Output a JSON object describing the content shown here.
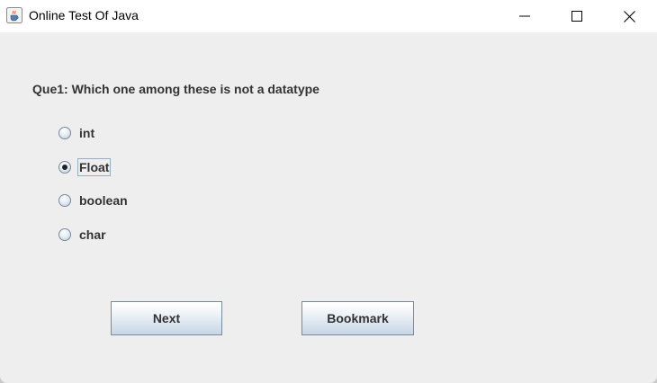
{
  "window": {
    "title": "Online Test Of Java",
    "app_icon": "java-coffee-icon",
    "controls": [
      "minimize-icon",
      "maximize-icon",
      "close-icon"
    ]
  },
  "question": {
    "text": "Que1: Which one among these is not a datatype"
  },
  "options": [
    {
      "label": "int",
      "selected": false
    },
    {
      "label": "Float",
      "selected": true
    },
    {
      "label": "boolean",
      "selected": false
    },
    {
      "label": "char",
      "selected": false
    }
  ],
  "buttons": {
    "next_label": "Next",
    "bookmark_label": "Bookmark"
  },
  "colors": {
    "content_background": "#eeeeee",
    "titlebar_background": "#ffffff",
    "text": "#333333"
  }
}
